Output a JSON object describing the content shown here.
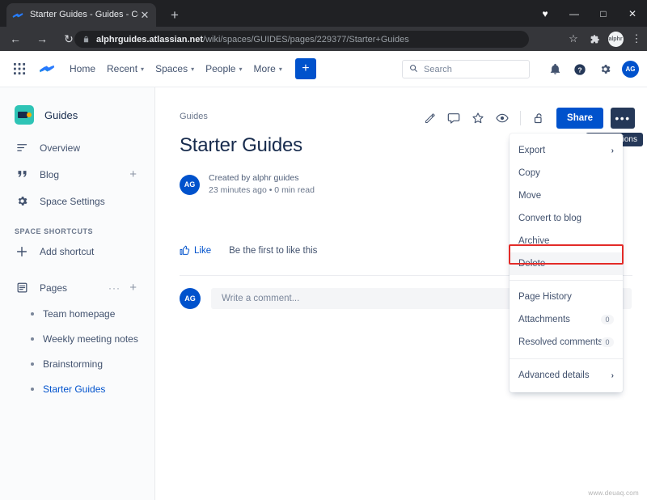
{
  "browser": {
    "tab": {
      "title": "Starter Guides - Guides - Conflue",
      "favicon": "confluence-icon",
      "close": "✕"
    },
    "new_tab": "+",
    "window_controls": {
      "minimize": "—",
      "maximize": "□",
      "close": "✕"
    },
    "heart_icon": "♥",
    "nav": {
      "back": "←",
      "forward": "→",
      "reload": "↻"
    },
    "omnibox": {
      "lock_icon": "lock-icon",
      "url_host": "alphrguides.atlassian.net",
      "url_path": "/wiki/spaces/GUIDES/pages/229377/Starter+Guides"
    },
    "toolbar": {
      "bookmark": "☆",
      "extensions": "puzzle-icon",
      "profile": "alphr",
      "menu": "⋮"
    }
  },
  "confluence_nav": {
    "app_switcher": "grid-icon",
    "logo": "confluence-logo",
    "items": [
      {
        "label": "Home",
        "has_caret": false
      },
      {
        "label": "Recent",
        "has_caret": true
      },
      {
        "label": "Spaces",
        "has_caret": true
      },
      {
        "label": "People",
        "has_caret": true
      },
      {
        "label": "More",
        "has_caret": true
      }
    ],
    "create_button": "+",
    "search": {
      "placeholder": "Search",
      "value": "",
      "icon": "search-icon"
    },
    "right_icons": [
      "notification-bell-icon",
      "help-icon",
      "settings-gear-icon"
    ],
    "avatar": "AG"
  },
  "sidebar": {
    "space_name": "Guides",
    "items": [
      {
        "label": "Overview",
        "icon": "overview-icon",
        "plus": false
      },
      {
        "label": "Blog",
        "icon": "blog-quote-icon",
        "plus": true
      },
      {
        "label": "Space Settings",
        "icon": "gear-icon",
        "plus": false
      }
    ],
    "section_label": "SPACE SHORTCUTS",
    "add_shortcut": {
      "label": "Add shortcut",
      "icon": "plus-icon"
    },
    "pages": {
      "label": "Pages",
      "icon": "pages-icon",
      "dots": "···",
      "plus": "+"
    },
    "tree": [
      {
        "label": "Team homepage",
        "active": false
      },
      {
        "label": "Weekly meeting notes",
        "active": false
      },
      {
        "label": "Brainstorming",
        "active": false
      },
      {
        "label": "Starter Guides",
        "active": true
      }
    ]
  },
  "page": {
    "breadcrumb": "Guides",
    "title": "Starter Guides",
    "author_avatar": "AG",
    "created_by": "Created by alphr guides",
    "meta": "23 minutes ago •  0 min read",
    "like_label": "Like",
    "like_note": "Be the first to like this",
    "comment_avatar": "AG",
    "comment_placeholder": "Write a comment..."
  },
  "page_toolbar": {
    "icons": [
      "edit-pencil-icon",
      "comment-icon",
      "star-icon",
      "watch-eye-icon"
    ],
    "restrictions_icon": "unlock-icon",
    "share_label": "Share",
    "more_label": "•••",
    "tooltip": "More actions"
  },
  "dropdown": {
    "items": [
      {
        "label": "Export",
        "chevron": "›",
        "badge": null,
        "selected": false,
        "sep_after": false
      },
      {
        "label": "Copy",
        "chevron": null,
        "badge": null,
        "selected": false,
        "sep_after": false
      },
      {
        "label": "Move",
        "chevron": null,
        "badge": null,
        "selected": false,
        "sep_after": false
      },
      {
        "label": "Convert to blog",
        "chevron": null,
        "badge": null,
        "selected": false,
        "sep_after": false
      },
      {
        "label": "Archive",
        "chevron": null,
        "badge": null,
        "selected": false,
        "sep_after": false
      },
      {
        "label": "Delete",
        "chevron": null,
        "badge": null,
        "selected": true,
        "sep_after": true
      },
      {
        "label": "Page History",
        "chevron": null,
        "badge": null,
        "selected": false,
        "sep_after": false
      },
      {
        "label": "Attachments",
        "chevron": null,
        "badge": "0",
        "selected": false,
        "sep_after": false
      },
      {
        "label": "Resolved comments",
        "chevron": null,
        "badge": "0",
        "selected": false,
        "sep_after": true
      },
      {
        "label": "Advanced details",
        "chevron": "›",
        "badge": null,
        "selected": false,
        "sep_after": false
      }
    ],
    "highlight_color": "#e32b28"
  },
  "watermark": "www.deuaq.com"
}
